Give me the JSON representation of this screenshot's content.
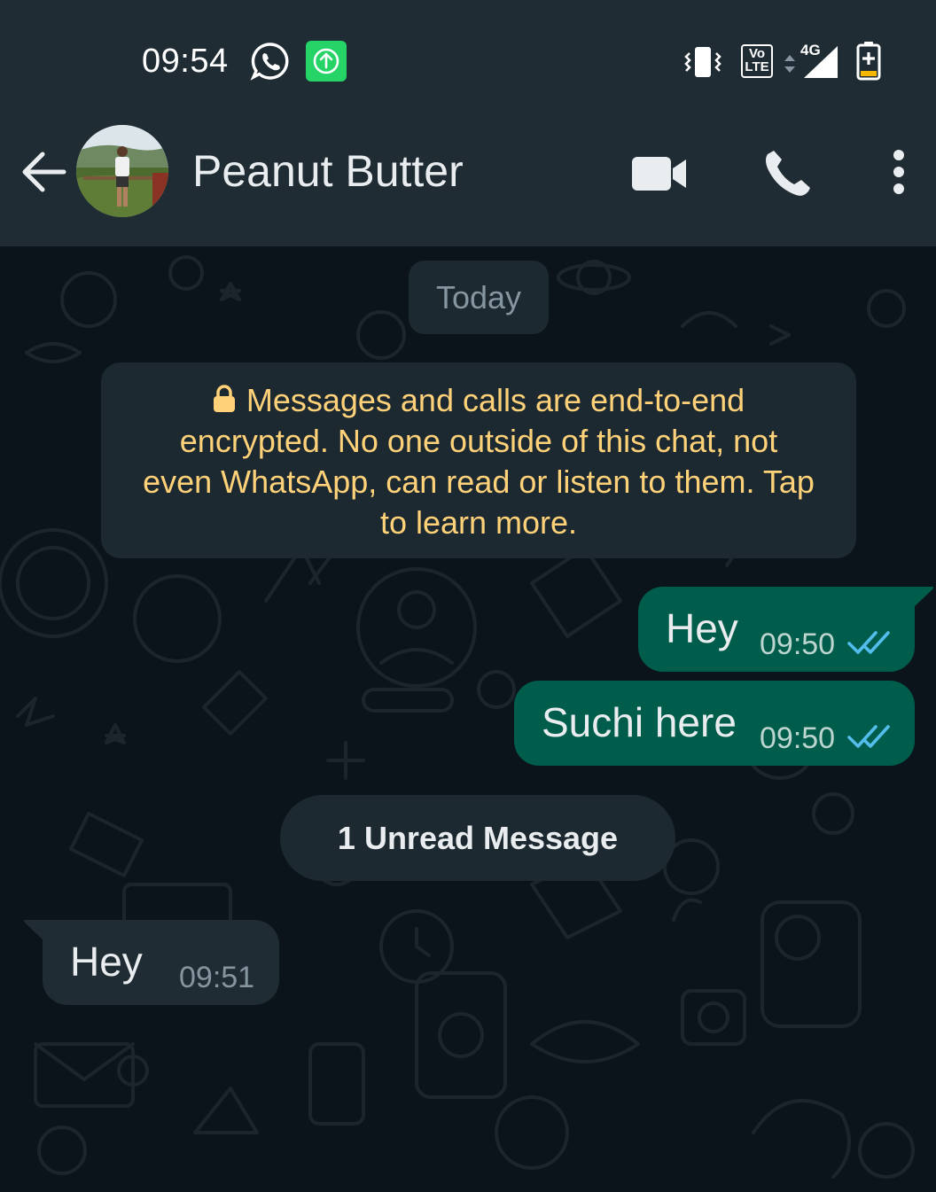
{
  "status_bar": {
    "time": "09:54",
    "network": "4G",
    "volte": [
      "Vo",
      "LTE"
    ],
    "icons": [
      "whatsapp-icon",
      "upload-notification-icon",
      "vibrate-icon",
      "volte-icon",
      "signal-icon",
      "battery-charging-icon"
    ]
  },
  "header": {
    "contact_name": "Peanut Butter",
    "icons": [
      "back-arrow-icon",
      "avatar",
      "video-call-icon",
      "phone-call-icon",
      "more-options-icon"
    ]
  },
  "chat": {
    "date_label": "Today",
    "encryption_notice": "Messages and calls are end-to-end encrypted. No one outside of this chat, not even WhatsApp, can read or listen to them. Tap to learn more.",
    "messages": [
      {
        "direction": "outgoing",
        "text": "Hey",
        "time": "09:50",
        "status": "read"
      },
      {
        "direction": "outgoing",
        "text": "Suchi here",
        "time": "09:50",
        "status": "read"
      },
      {
        "direction": "incoming",
        "text": "Hey",
        "time": "09:51"
      }
    ],
    "unread_label": "1 Unread Message"
  },
  "colors": {
    "header_bg": "#1f2c34",
    "chat_bg": "#0b141a",
    "outgoing_bubble": "#005c4b",
    "incoming_bubble": "#1f2c34",
    "encryption_text": "#ffd279",
    "read_tick": "#53bdeb"
  }
}
